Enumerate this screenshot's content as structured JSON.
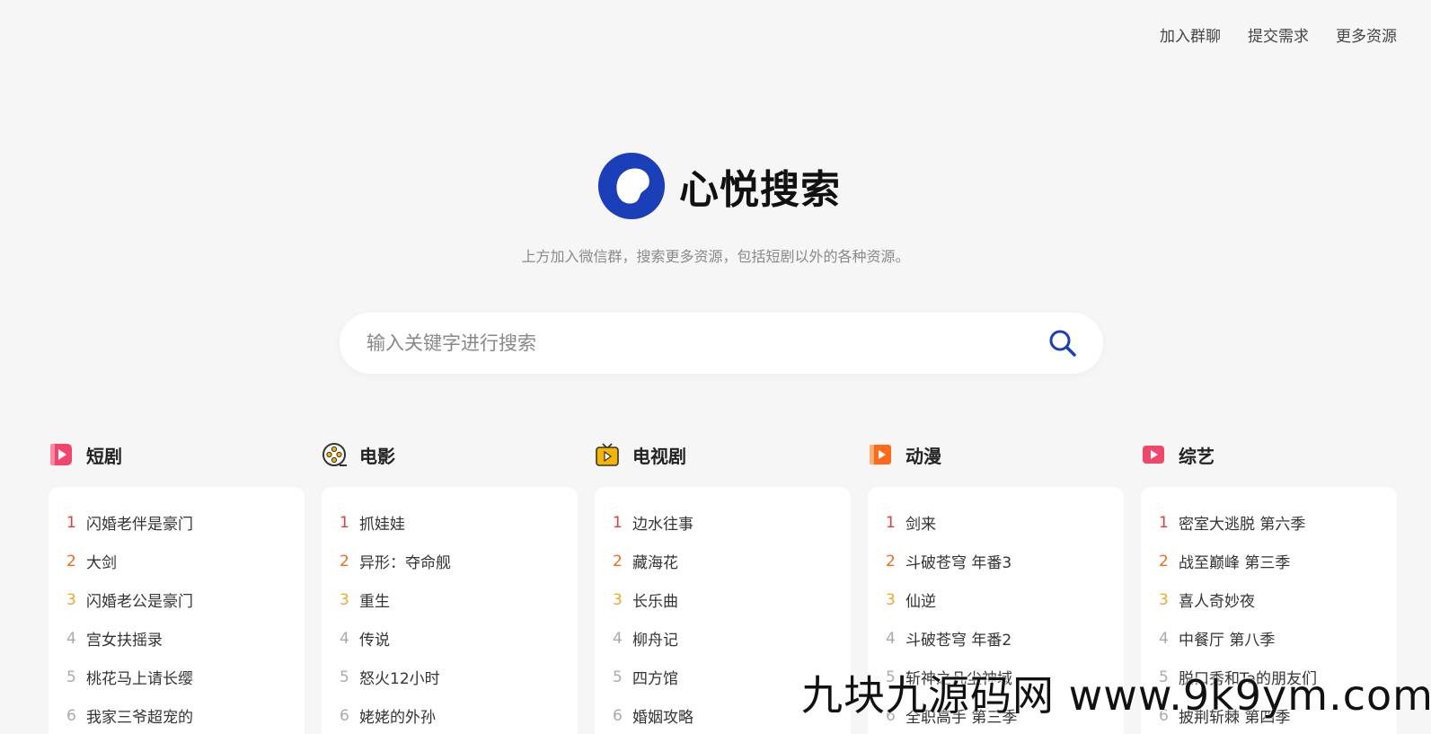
{
  "nav": {
    "links": [
      "加入群聊",
      "提交需求",
      "更多资源"
    ]
  },
  "brand": {
    "name": "心悦搜索",
    "color": "#1b3fb8"
  },
  "subtitle": "上方加入微信群，搜索更多资源，包括短剧以外的各种资源。",
  "search": {
    "placeholder": "输入关键字进行搜索",
    "icon": "search-icon"
  },
  "categories": [
    {
      "title": "短剧",
      "icon": "short-drama-icon",
      "color": "#f0466b",
      "items": [
        "闪婚老伴是豪门",
        "大剑",
        "闪婚老公是豪门",
        "宫女扶摇录",
        "桃花马上请长缨",
        "我家三爷超宠的"
      ]
    },
    {
      "title": "电影",
      "icon": "film-reel-icon",
      "color": "#333333",
      "items": [
        "抓娃娃",
        "异形：夺命舰",
        "重生",
        "传说",
        "怒火12小时",
        "姥姥的外孙"
      ]
    },
    {
      "title": "电视剧",
      "icon": "tv-icon",
      "color": "#f5b400",
      "items": [
        "边水往事",
        "藏海花",
        "长乐曲",
        "柳舟记",
        "四方馆",
        "婚姻攻略"
      ]
    },
    {
      "title": "动漫",
      "icon": "anime-icon",
      "color": "#ff6a1a",
      "items": [
        "剑来",
        "斗破苍穹 年番3",
        "仙逆",
        "斗破苍穹 年番2",
        "斩神之凡尘神域",
        "全职高手 第三季"
      ]
    },
    {
      "title": "综艺",
      "icon": "variety-icon",
      "color": "#f0466b",
      "items": [
        "密室大逃脱 第六季",
        "战至巅峰 第三季",
        "喜人奇妙夜",
        "中餐厅 第八季",
        "脱口秀和Ta的朋友们",
        "披荆斩棘 第四季"
      ]
    }
  ],
  "ranks": [
    "1",
    "2",
    "3",
    "4",
    "5",
    "6"
  ],
  "watermark": "九块九源码网 www.9k9ym.com"
}
